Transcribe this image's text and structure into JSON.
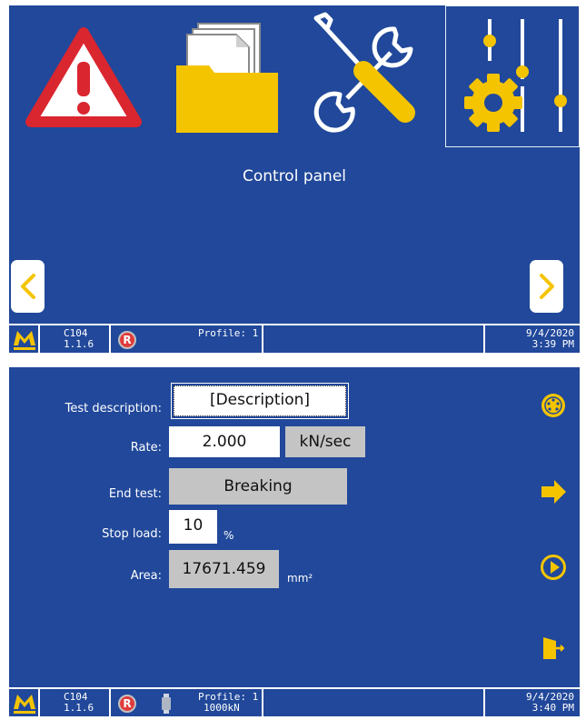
{
  "menu": {
    "caption": "Control panel",
    "tiles": [
      {
        "icon": "warning-triangle-icon"
      },
      {
        "icon": "folder-documents-icon"
      },
      {
        "icon": "tools-icon"
      },
      {
        "icon": "settings-sliders-gear-icon",
        "selected": true
      }
    ]
  },
  "status_top": {
    "model": "C104",
    "version": "1.1.6",
    "profile": "Profile: 1",
    "date": "9/4/2020",
    "time": "3:39 PM"
  },
  "form": {
    "description_label": "Test description:",
    "description_value": "[Description]",
    "rate_label": "Rate:",
    "rate_value": "2.000",
    "rate_unit": "kN/sec",
    "end_label": "End test:",
    "end_value": "Breaking",
    "stop_label": "Stop load:",
    "stop_value": "10",
    "stop_unit": "%",
    "area_label": "Area:",
    "area_value": "17671.459",
    "area_unit": "mm²"
  },
  "status_bottom": {
    "model": "C104",
    "version": "1.1.6",
    "profile": "Profile: 1",
    "capacity": "1000kN",
    "date": "9/4/2020",
    "time": "3:40 PM"
  },
  "colors": {
    "background": "#21489a",
    "accent_yellow": "#f5c400",
    "warning_red": "#d9262f",
    "field_grey": "#c4c4c4"
  }
}
